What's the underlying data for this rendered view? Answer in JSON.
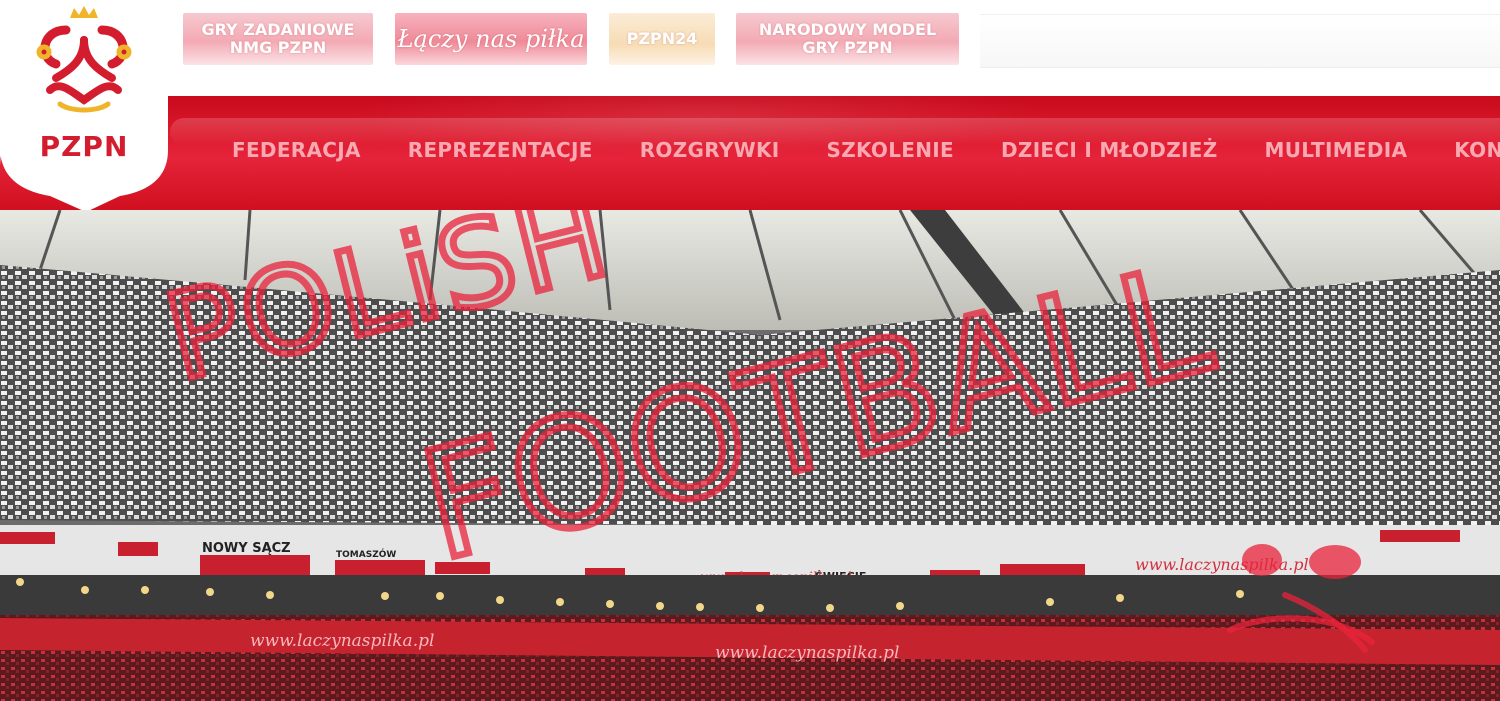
{
  "brand": {
    "logo_text": "PZPN",
    "primary_color": "#d41c2f",
    "accent_color": "#e5233a"
  },
  "promos": [
    {
      "line1": "GRY ZADANIOWE",
      "line2": "NMG PZPN"
    },
    {
      "line1": "Łączy nas piłka",
      "line2": ""
    },
    {
      "line1": "PZPN24",
      "line2": ""
    },
    {
      "line1": "NARODOWY MODEL",
      "line2": "GRY PZPN"
    }
  ],
  "nav": {
    "items": [
      "FEDERACJA",
      "REPREZENTACJE",
      "ROZGRYWKI",
      "SZKOLENIE",
      "DZIECI I MŁODZIEŻ",
      "MULTIMEDIA",
      "KONTAKT"
    ]
  },
  "hero": {
    "scribble_line1": "POLiSH",
    "scribble_line2": "FOOTBALL",
    "banners": [
      "NOWY SĄCZ",
      "TOMASZÓW",
      "ŚWIECIE",
      "www.laczynaspilka.pl",
      "www.laczynaspilka.pl",
      "www.laczynaspilka.pl",
      "www.laczynaspilka.pl"
    ]
  }
}
